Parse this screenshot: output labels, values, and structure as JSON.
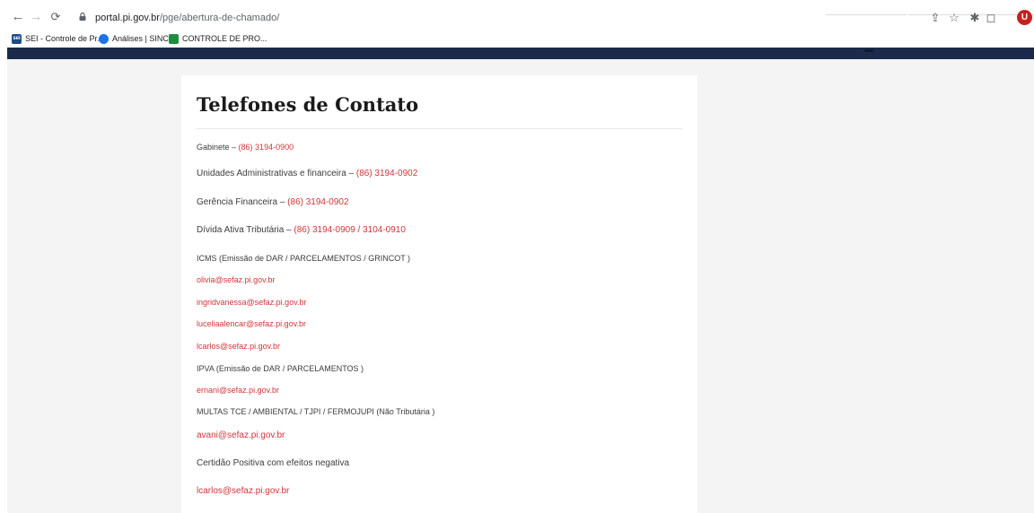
{
  "browser": {
    "url_host": "portal.pi.gov.br",
    "url_path": "/pge/abertura-de-chamado/",
    "avatar_letter": "U",
    "bookmarks": [
      {
        "label": "SEI - Controle de Pr...",
        "icon_text": "sei"
      },
      {
        "label": "Análises | SINCIN"
      },
      {
        "label": "CONTROLE DE PRO..."
      }
    ]
  },
  "content": {
    "title": "Telefones de Contato",
    "gabinete": {
      "label": "Gabinete – ",
      "phone": "(86) 3194-0900"
    },
    "unidades": {
      "label": "Unidades Administrativas e financeira – ",
      "phone": "(86) 3194-0902"
    },
    "gerencia": {
      "label": "Gerência Financeira – ",
      "phone": "(86) 3194-0902"
    },
    "divida": {
      "label": "Dívida Ativa Tributária – ",
      "phone": "(86) 3194-0909 / 3104-0910"
    },
    "icms_heading": "ICMS (Emissão de DAR / PARCELAMENTOS / GRINCOT )",
    "icms_emails": [
      "olivia@sefaz.pi.gov.br",
      "ingridvanessa@sefaz.pi.gov.br",
      "luceliaalencar@sefaz.pi.gov.br",
      "lcarlos@sefaz.pi.gov.br"
    ],
    "ipva_heading": "IPVA (Emissão de DAR / PARCELAMENTOS )",
    "ipva_email": "ernani@sefaz.pi.gov.br",
    "multas_heading": "MULTAS TCE / AMBIENTAL / TJPI / FERMOJUPI (Não Tributária )",
    "multas_email": "avani@sefaz.pi.gov.br",
    "certidao_heading": "Certidão Positiva com efeitos negativa",
    "certidao_email": "lcarlos@sefaz.pi.gov.br"
  },
  "colors": {
    "header_band": "#1b2a4a",
    "link_red": "#d1343a",
    "page_bg": "#f4f4f4"
  }
}
